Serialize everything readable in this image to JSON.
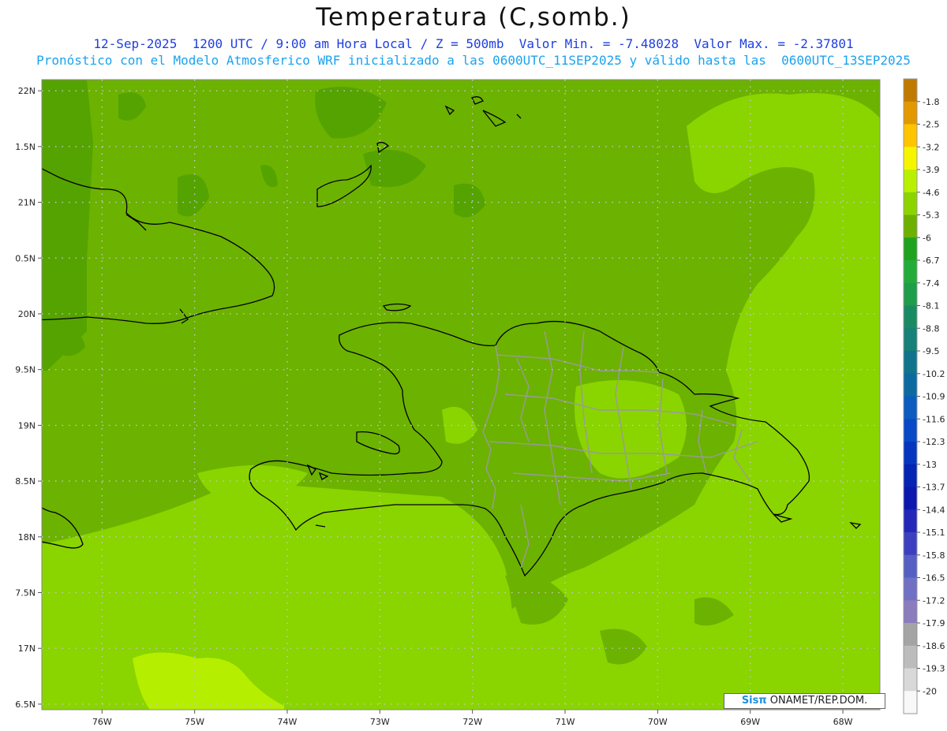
{
  "title": "Temperatura (C,somb.)",
  "subtitle1": "12-Sep-2025  1200 UTC / 9:00 am Hora Local / Z = 500mb  Valor Min. = -7.48028  Valor Max. = -2.37801",
  "subtitle2": "Pronóstico con el Modelo Atmosferico WRF inicializado a las 0600UTC_11SEP2025 y válido hasta las  0600UTC_13SEP2025",
  "credit": {
    "logo": "Sisπ",
    "text": " ONAMET/REP.DOM."
  },
  "map": {
    "lon_range": [
      -76.65,
      -67.6
    ],
    "lat_range": [
      16.45,
      22.1
    ],
    "x_ticks": [
      "76W",
      "75W",
      "74W",
      "73W",
      "72W",
      "71W",
      "70W",
      "69W",
      "68W"
    ],
    "x_tick_values": [
      -76,
      -75,
      -74,
      -73,
      -72,
      -71,
      -70,
      -69,
      -68
    ],
    "y_ticks": [
      "22N",
      "1.5N",
      "21N",
      "0.5N",
      "20N",
      "9.5N",
      "19N",
      "8.5N",
      "18N",
      "7.5N",
      "17N",
      "6.5N"
    ],
    "y_tick_values": [
      22,
      21.5,
      21,
      20.5,
      20,
      19.5,
      19,
      18.5,
      18,
      17.5,
      17,
      16.5
    ]
  },
  "legend": {
    "labels": [
      "-1.8",
      "-2.5",
      "-3.2",
      "-3.9",
      "-4.6",
      "-5.3",
      "-6",
      "-6.7",
      "-7.4",
      "-8.1",
      "-8.8",
      "-9.5",
      "-10.2",
      "-10.9",
      "-11.6",
      "-12.3",
      "-13",
      "-13.7",
      "-14.4",
      "-15.1",
      "-15.8",
      "-16.5",
      "-17.2",
      "-17.9",
      "-18.6",
      "-19.3",
      "-20"
    ],
    "colors": [
      "#c07a00",
      "#e39800",
      "#ffc400",
      "#f5f500",
      "#b9f000",
      "#8cd400",
      "#6eb000",
      "#1fa31f",
      "#22ad3a",
      "#1e9e4a",
      "#1a8a63",
      "#178078",
      "#11748c",
      "#0c6aa0",
      "#0a5cc0",
      "#0849c8",
      "#0636c0",
      "#0424b4",
      "#0a18b0",
      "#2428b8",
      "#3c40c0",
      "#5660c4",
      "#7070c4",
      "#8a7cbe",
      "#a4a4a4",
      "#bcbcbc",
      "#d8d8d8",
      "#f8f8f8"
    ]
  },
  "field_colors": {
    "dark": "#55a300",
    "mid": "#6cb200",
    "light": "#8ad400",
    "yellowgreen": "#b6ee00"
  }
}
